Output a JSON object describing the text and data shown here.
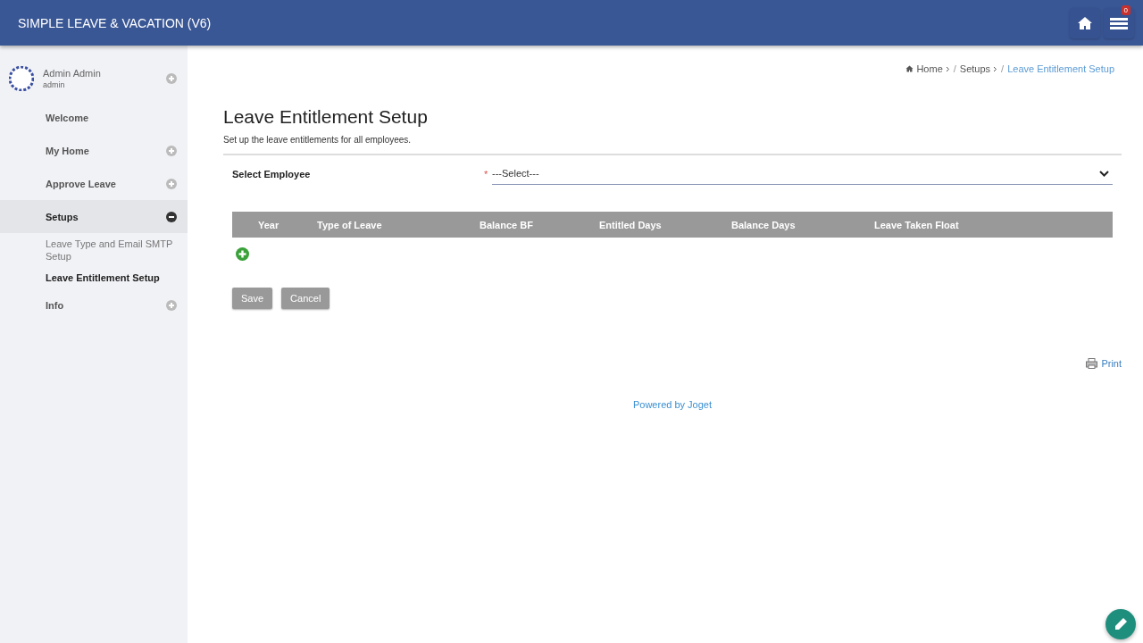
{
  "app_title": "SIMPLE LEAVE & VACATION (V6)",
  "notification_count": "0",
  "user": {
    "name": "Admin Admin",
    "username": "admin",
    "expanded": false
  },
  "sidebar": {
    "items": [
      {
        "label": "Welcome",
        "kind": "link",
        "selected": false
      },
      {
        "label": "My Home",
        "kind": "group",
        "expanded": false,
        "selected": false
      },
      {
        "label": "Approve Leave",
        "kind": "group",
        "expanded": false,
        "selected": false
      },
      {
        "label": "Setups",
        "kind": "group",
        "expanded": true,
        "selected": true,
        "children": [
          {
            "label": "Leave Type and Email SMTP Setup",
            "selected": false
          },
          {
            "label": "Leave Entitlement Setup",
            "selected": true
          }
        ]
      },
      {
        "label": "Info",
        "kind": "group",
        "expanded": false,
        "selected": false
      }
    ]
  },
  "breadcrumb_separator": "/",
  "breadcrumb": [
    {
      "label": "Home",
      "current": false
    },
    {
      "label": "Setups",
      "current": false
    },
    {
      "label": "Leave Entitlement Setup",
      "current": true
    }
  ],
  "page": {
    "title": "Leave Entitlement Setup",
    "description": "Set up the leave entitlements for all employees."
  },
  "form": {
    "label": "Select Employee",
    "required_mark": "*",
    "value": "---Select---"
  },
  "table": {
    "columns": [
      "Year",
      "Type of Leave",
      "Balance BF",
      "Entitled Days",
      "Balance Days",
      "Leave Taken Float"
    ]
  },
  "buttons": [
    "Save",
    "Cancel"
  ],
  "print_link": "Print",
  "footer": "Powered by Joget"
}
